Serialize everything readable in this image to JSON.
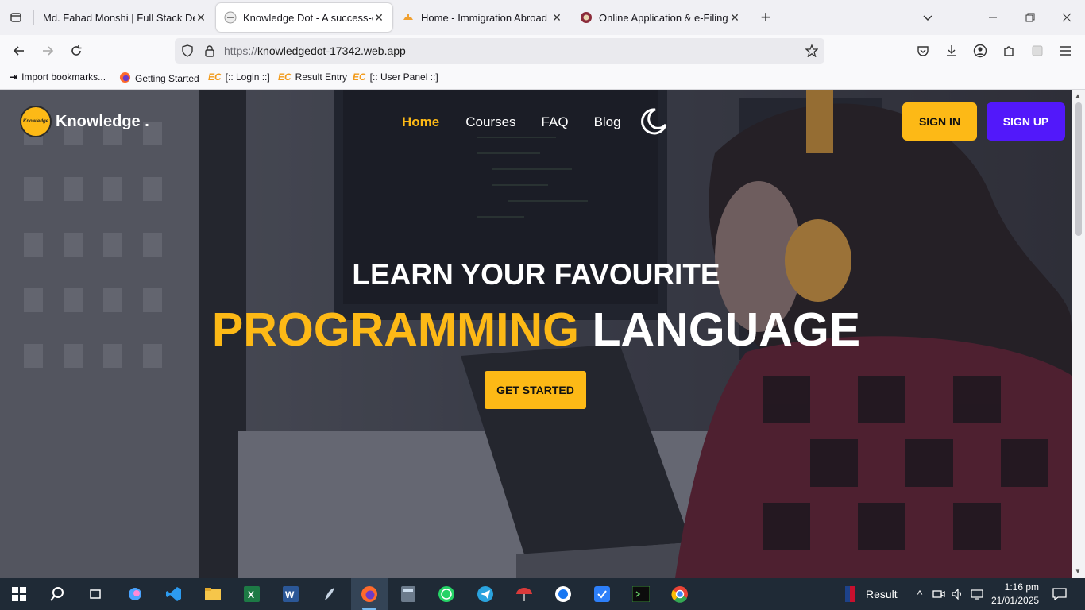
{
  "browser": {
    "tabs": [
      {
        "title": "Md. Fahad Monshi | Full Stack Devel",
        "active": false
      },
      {
        "title": "Knowledge Dot - A success-orie",
        "active": true
      },
      {
        "title": "Home - Immigration Abroad",
        "active": false
      },
      {
        "title": "Online Application & e-Filing Sy",
        "active": false
      }
    ],
    "new_tab": "+",
    "url_protocol": "https://",
    "url_host": "knowledgedot-17342.web.app",
    "bookmarks": [
      {
        "label": "Import bookmarks...",
        "icon": "import-icon"
      },
      {
        "label": "Getting Started",
        "icon": "firefox-icon"
      },
      {
        "label": "[:: Login ::]",
        "icon": "ec-icon"
      },
      {
        "label": "Result Entry",
        "icon": "ec-icon"
      },
      {
        "label": "[:: User Panel ::]",
        "icon": "ec-icon"
      }
    ]
  },
  "site": {
    "logo_badge": "Knowledge",
    "logo_text": "Knowledge .",
    "nav": [
      "Home",
      "Courses",
      "FAQ",
      "Blog"
    ],
    "sign_in": "SIGN IN",
    "sign_up": "SIGN UP",
    "hero_line1": "LEARN YOUR FAVOURITE",
    "hero_highlight": "PROGRAMMING",
    "hero_rest": "LANGUAGE",
    "cta": "GET STARTED",
    "colors": {
      "accent": "#fdb916",
      "purple": "#5218fa"
    }
  },
  "taskbar": {
    "weather_label": "Result",
    "time": "1:16 pm",
    "date": "21/01/2025"
  }
}
